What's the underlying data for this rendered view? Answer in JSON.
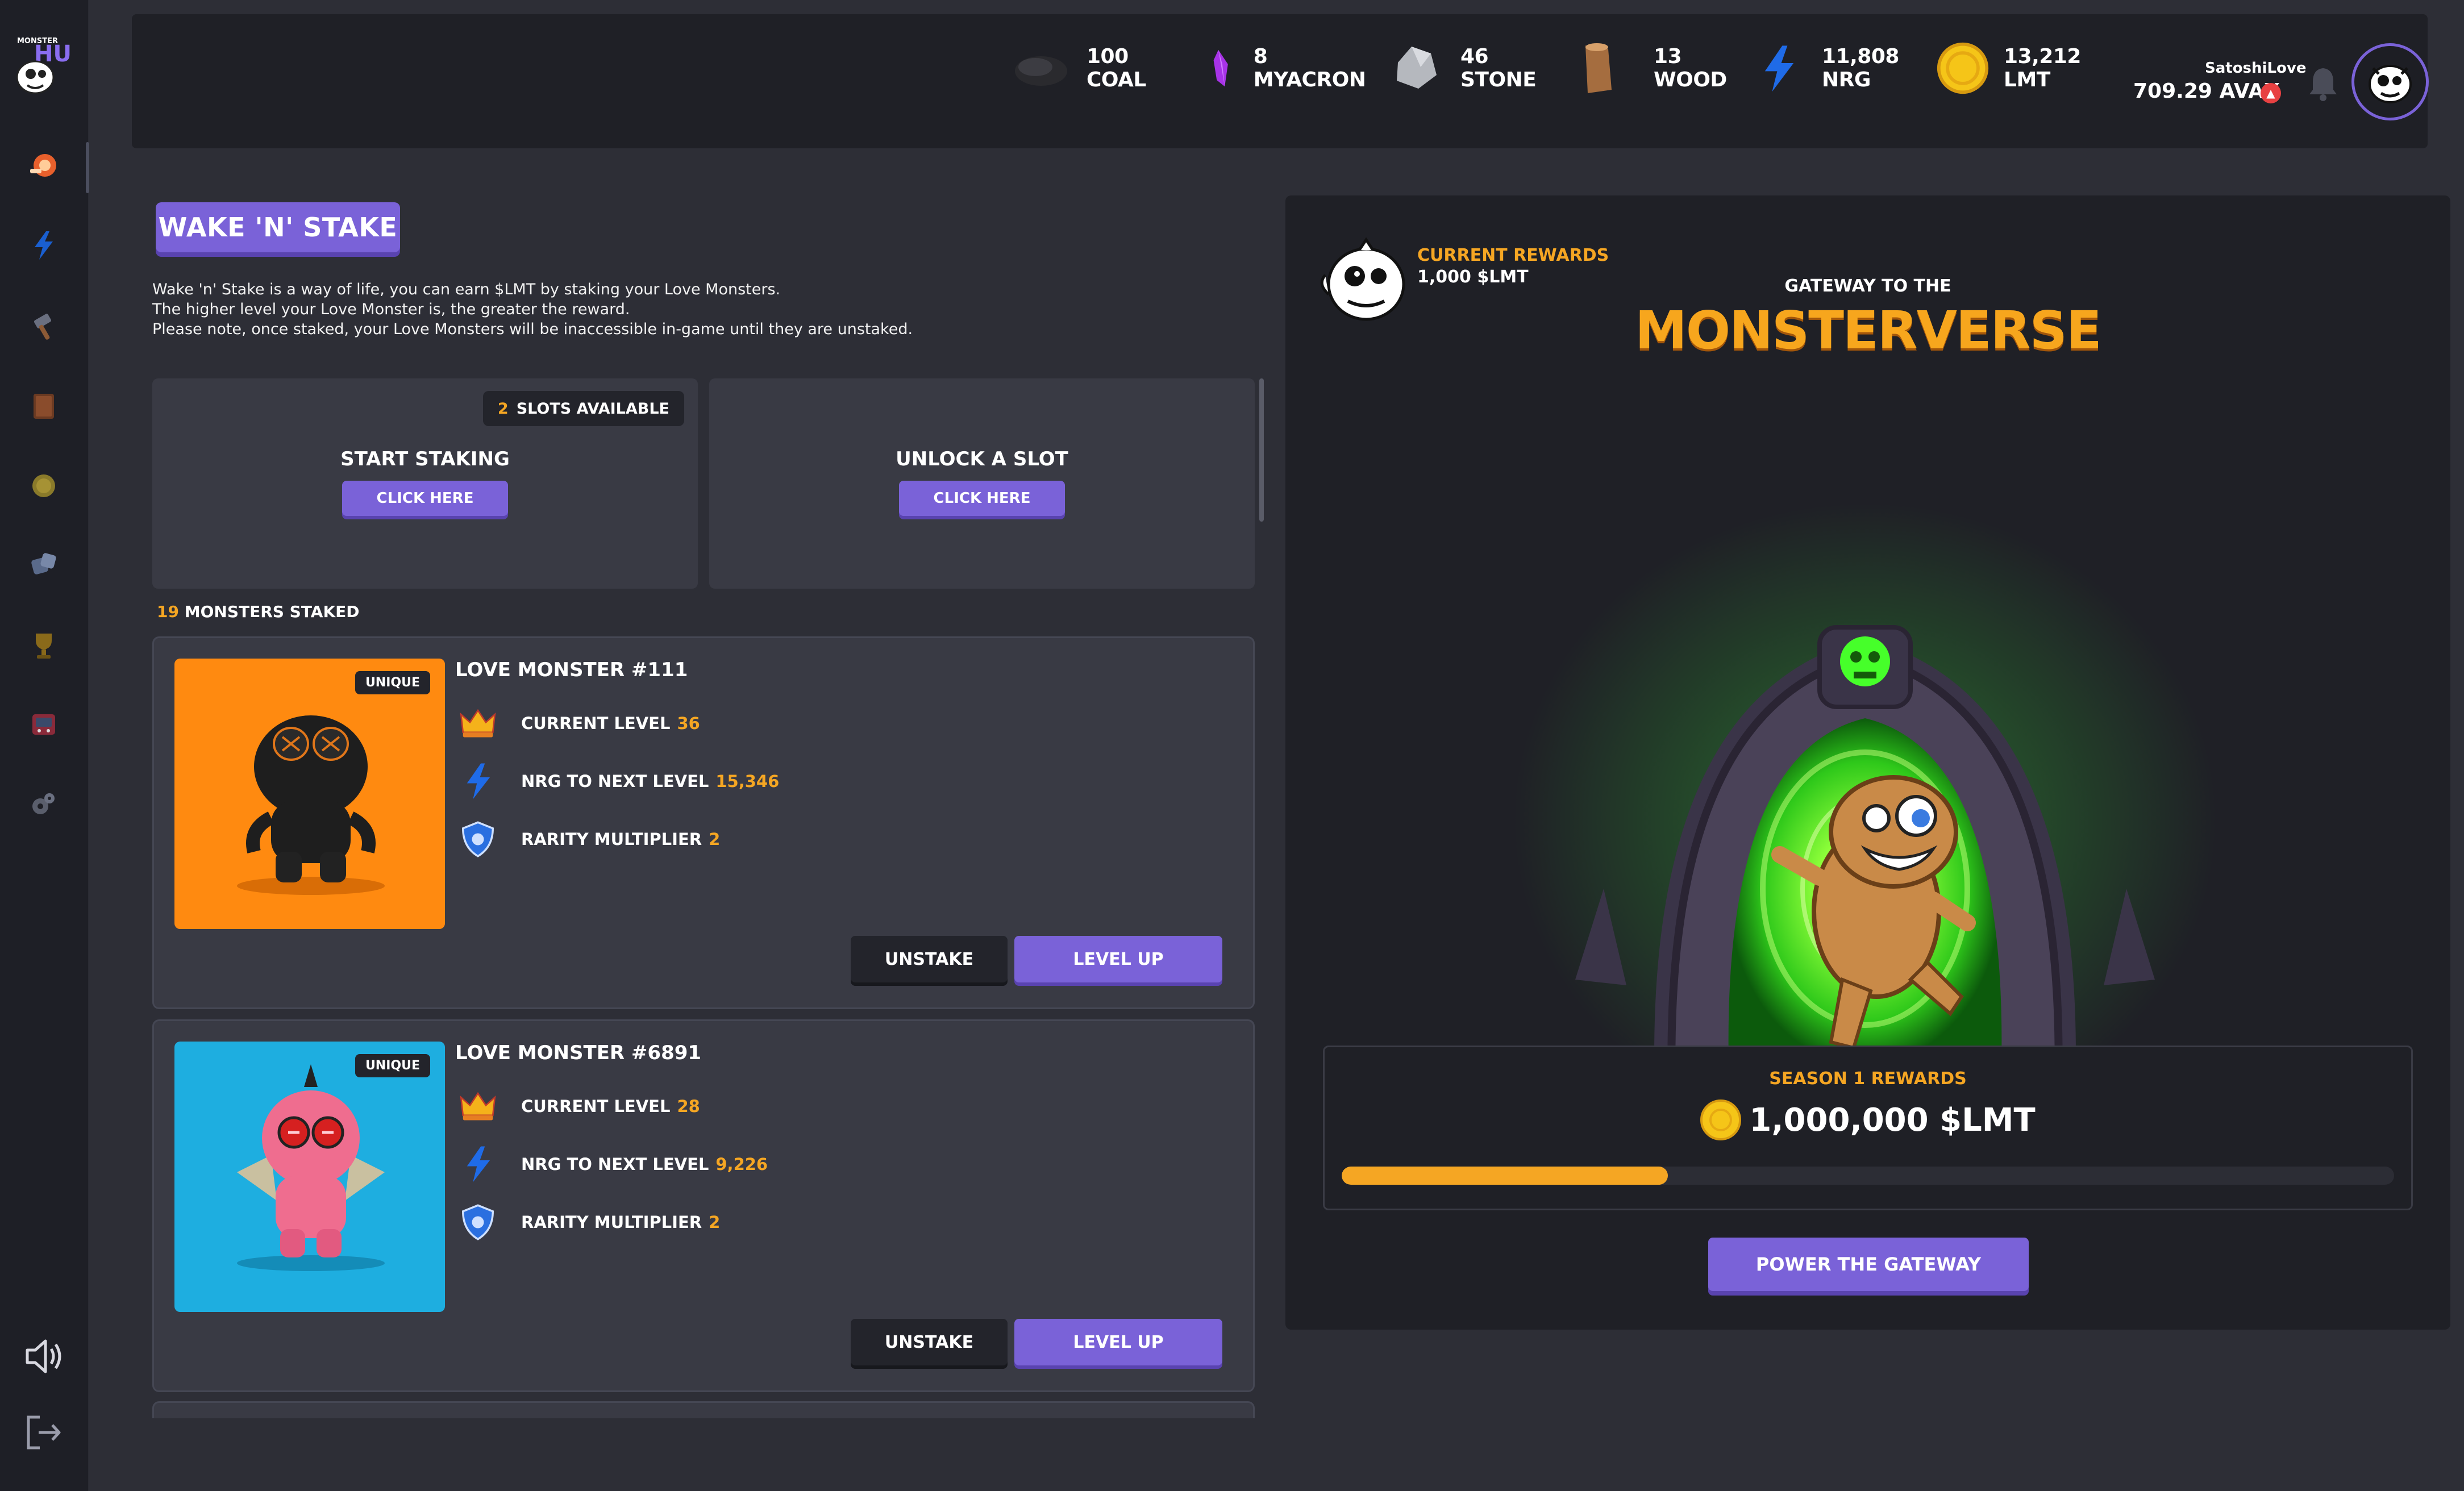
{
  "app": {
    "logo_text_top": "MONSTER",
    "logo_text_main": "HUB"
  },
  "sidebar": {
    "items": [
      {
        "icon": "staking-icon",
        "active": true
      },
      {
        "icon": "energy-icon"
      },
      {
        "icon": "hammer-icon"
      },
      {
        "icon": "book-icon"
      },
      {
        "icon": "coin-icon"
      },
      {
        "icon": "dice-icon"
      },
      {
        "icon": "trophy-icon"
      },
      {
        "icon": "arcade-icon"
      },
      {
        "icon": "gear-icon"
      }
    ],
    "bottom": [
      "sound-icon",
      "logout-icon"
    ]
  },
  "resources": [
    {
      "name": "coal",
      "label": "100 COAL"
    },
    {
      "name": "myacron",
      "label": "8 MYACRON"
    },
    {
      "name": "stone",
      "label": "46 STONE"
    },
    {
      "name": "wood",
      "label": "13 WOOD"
    },
    {
      "name": "nrg",
      "label": "11,808 NRG"
    },
    {
      "name": "lmt",
      "label": "13,212 LMT"
    }
  ],
  "user": {
    "name": "SatoshiLove",
    "balance": "709.29 AVAX"
  },
  "stake": {
    "title": "WAKE 'N' STAKE",
    "description": [
      "Wake 'n' Stake is a way of life, you can earn $LMT by staking your Love Monsters.",
      "The higher level your Love Monster is, the greater the reward.",
      "Please note, once staked, your Love Monsters will be inaccessible in-game until they are unstaked."
    ],
    "slots_count": "2",
    "slots_label": "SLOTS AVAILABLE",
    "start_title": "START STAKING",
    "unlock_title": "UNLOCK A SLOT",
    "click_here": "CLICK HERE",
    "staked_count": "19",
    "staked_label": "MONSTERS STAKED"
  },
  "monsters": [
    {
      "name": "LOVE MONSTER #111",
      "badge": "UNIQUE",
      "bg_color": "#ff8a10",
      "level_label": "CURRENT LEVEL",
      "level": "36",
      "nrg_label": "NRG TO NEXT LEVEL",
      "nrg": "15,346",
      "rarity_label": "RARITY MULTIPLIER",
      "rarity": "2",
      "unstake": "UNSTAKE",
      "levelup": "LEVEL UP"
    },
    {
      "name": "LOVE MONSTER #6891",
      "badge": "UNIQUE",
      "bg_color": "#1eaee0",
      "level_label": "CURRENT LEVEL",
      "level": "28",
      "nrg_label": "NRG TO NEXT LEVEL",
      "nrg": "9,226",
      "rarity_label": "RARITY MULTIPLIER",
      "rarity": "2",
      "unstake": "UNSTAKE",
      "levelup": "LEVEL UP"
    }
  ],
  "gateway": {
    "current_rewards_label": "CURRENT REWARDS",
    "current_rewards_value": "1,000 $LMT",
    "subtitle": "GATEWAY TO THE",
    "title": "MONSTERVERSE",
    "season_label": "SEASON 1 REWARDS",
    "season_value": "1,000,000 $LMT",
    "season_progress": 0.31,
    "power_button": "POWER THE GATEWAY"
  },
  "colors": {
    "accent": "#7a62d8",
    "highlight": "#f5a623",
    "background": "#2d2e36"
  }
}
